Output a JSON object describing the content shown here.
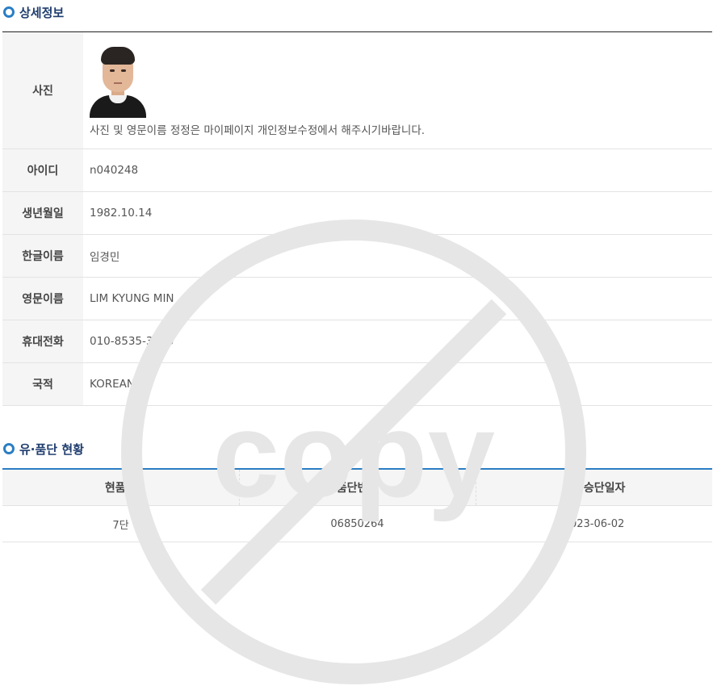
{
  "detail_section": {
    "title": "상세정보",
    "photo_label": "사진",
    "photo_note": "사진 및 영문이름 정정은 마이페이지 개인정보수정에서 해주시기바랍니다.",
    "rows": [
      {
        "label": "아이디",
        "value": "n040248"
      },
      {
        "label": "생년월일",
        "value": "1982.10.14"
      },
      {
        "label": "한글이름",
        "value": "임경민"
      },
      {
        "label": "영문이름",
        "value": "LIM KYUNG MIN"
      },
      {
        "label": "휴대전화",
        "value": "010-8535-3413"
      },
      {
        "label": "국적",
        "value": "KOREAN"
      }
    ]
  },
  "status_section": {
    "title": "유·품단 현황",
    "columns": [
      "현품단",
      "품단번호",
      "최종승단일자"
    ],
    "rows": [
      [
        "7단",
        "06850264",
        "2023-06-02"
      ]
    ]
  },
  "watermark": {
    "text": "copy",
    "color": "#e6e6e6"
  },
  "colors": {
    "accent": "#2a7ec4",
    "title": "#1f3d6e",
    "header_bg": "#f5f5f5"
  }
}
